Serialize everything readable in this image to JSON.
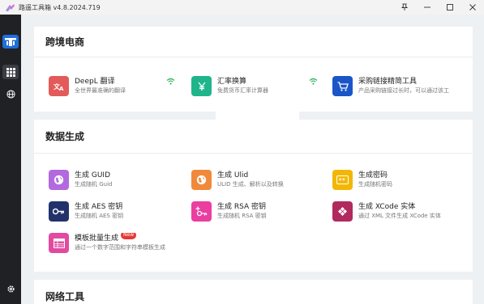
{
  "window": {
    "title": "路遥工具箱 v4.8.2024.719"
  },
  "sections": [
    {
      "title": "跨境电商",
      "tools": [
        {
          "name": "DeepL 翻译",
          "desc": "全世界最准确的翻译",
          "icon": "translate-icon",
          "color": "#e35a5a"
        },
        {
          "name": "汇率换算",
          "desc": "免费货币汇率计算器",
          "icon": "yen-icon",
          "color": "#1eb58a"
        },
        {
          "name": "采购链接精简工具",
          "desc": "产品采购链接过长时，可以通过该工",
          "icon": "cart-icon",
          "color": "#1a56c8"
        }
      ]
    },
    {
      "title": "数据生成",
      "tools": [
        {
          "name": "生成 GUID",
          "desc": "生成随机 Guid",
          "icon": "globe-icon",
          "color": "#b26adf"
        },
        {
          "name": "生成 Ulid",
          "desc": "ULID 生成、解析以及转换",
          "icon": "globe-icon",
          "color": "#f08a3a"
        },
        {
          "name": "生成密码",
          "desc": "生成随机密码",
          "icon": "password-icon",
          "color": "#f2b705"
        },
        {
          "name": "生成 AES 密钥",
          "desc": "生成随机 AES 密钥",
          "icon": "key-icon",
          "color": "#23326b"
        },
        {
          "name": "生成 RSA 密钥",
          "desc": "生成随机 RSA 密钥",
          "icon": "key-plus-icon",
          "color": "#ea3ea0"
        },
        {
          "name": "生成 XCode 实体",
          "desc": "通过 XML 文件生成 XCode 实体",
          "icon": "puzzle-icon",
          "color": "#b02a5e"
        },
        {
          "name": "模板批量生成",
          "desc": "通过一个数字范围和字符串模板生成",
          "icon": "table-icon",
          "color": "#e14aa0",
          "badge": "New"
        }
      ]
    },
    {
      "title": "网络工具",
      "tools": []
    }
  ],
  "colors": {
    "sidebar": "#1f2125",
    "accent": "#1e6fd9",
    "wifi": "#22b14c"
  }
}
